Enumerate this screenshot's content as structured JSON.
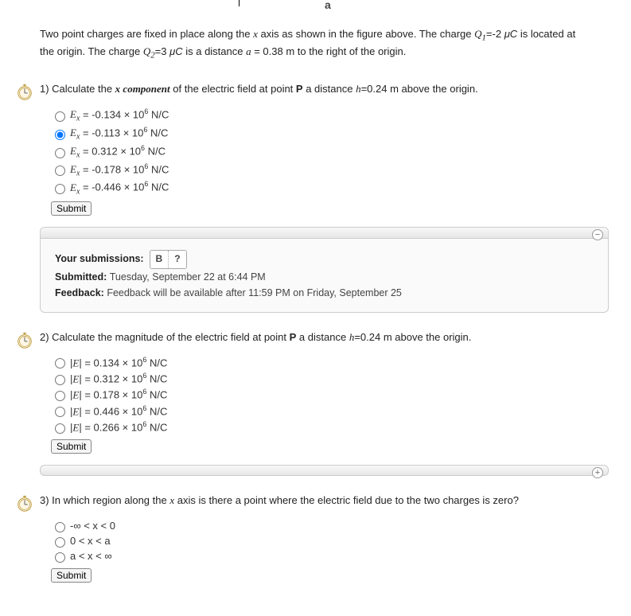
{
  "intro": {
    "pre_q1": "Two point charges are fixed in place along the ",
    "xaxis": "x",
    "post_xaxis": " axis as shown in the figure above. The charge ",
    "q1sym": "Q",
    "q1sub": "1",
    "eq1": "=-2 ",
    "muC": "μC",
    "located": " is located at the origin. The charge ",
    "q2sym": "Q",
    "q2sub": "2",
    "eq2": "=3 ",
    "dist_label": " is a distance ",
    "avar": "a",
    "aeq": " = 0.38 m to the right of the origin."
  },
  "q1": {
    "num": "1) ",
    "text_a": "Calculate the ",
    "xcomp": "x component",
    "text_b": " of the electric field at point ",
    "pvar": "P",
    "text_c": " a distance ",
    "hvar": "h",
    "text_d": "=0.24 m above the origin.",
    "options": [
      "-0.134 × 10⁶ N/C",
      "-0.113 × 10⁶ N/C",
      "0.312 × 10⁶ N/C",
      "-0.178 × 10⁶ N/C",
      "-0.446 × 10⁶ N/C"
    ],
    "selected_index": 1,
    "submit": "Submit",
    "fb_yoursub": "Your submissions:",
    "fb_grade": "B",
    "fb_q": "?",
    "fb_submitted_lbl": "Submitted: ",
    "fb_submitted_val": "Tuesday, September 22 at 6:44 PM",
    "fb_feedback_lbl": "Feedback: ",
    "fb_feedback_val": "Feedback will be available after 11:59 PM on Friday, September 25"
  },
  "q2": {
    "num": "2) ",
    "text_a": "Calculate the magnitude of the electric field at point ",
    "pvar": "P",
    "text_b": " a distance ",
    "hvar": "h",
    "text_c": "=0.24 m above the origin.",
    "options": [
      "0.134 × 10⁶ N/C",
      "0.312 × 10⁶ N/C",
      "0.178 × 10⁶ N/C",
      "0.446 × 10⁶ N/C",
      "0.266 × 10⁶ N/C"
    ],
    "submit": "Submit"
  },
  "q3": {
    "num": "3) ",
    "text_a": "In which region along the ",
    "xvar": "x",
    "text_b": " axis is there a point where the electric field due to the two charges is zero?",
    "options": [
      "-∞ < x < 0",
      "0 < x < a",
      "a < x < ∞"
    ],
    "submit": "Submit"
  },
  "top_a": "a"
}
